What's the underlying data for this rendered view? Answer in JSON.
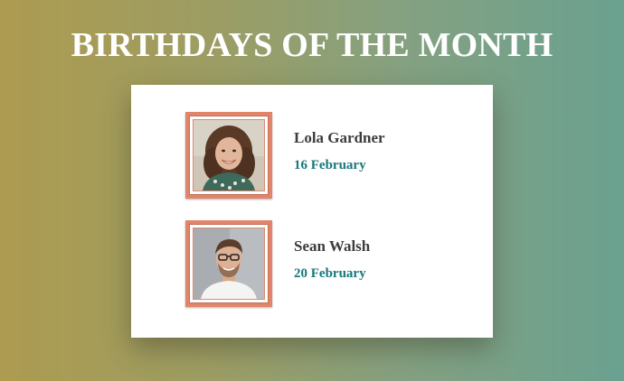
{
  "title": "BIRTHDAYS OF THE MONTH",
  "people": [
    {
      "name": "Lola Gardner",
      "date": "16 February",
      "avatar": "woman-portrait"
    },
    {
      "name": "Sean Walsh",
      "date": "20 February",
      "avatar": "man-portrait"
    }
  ],
  "colors": {
    "frame": "#e0856a",
    "date_text": "#17777a",
    "name_text": "#3c3c3c"
  }
}
